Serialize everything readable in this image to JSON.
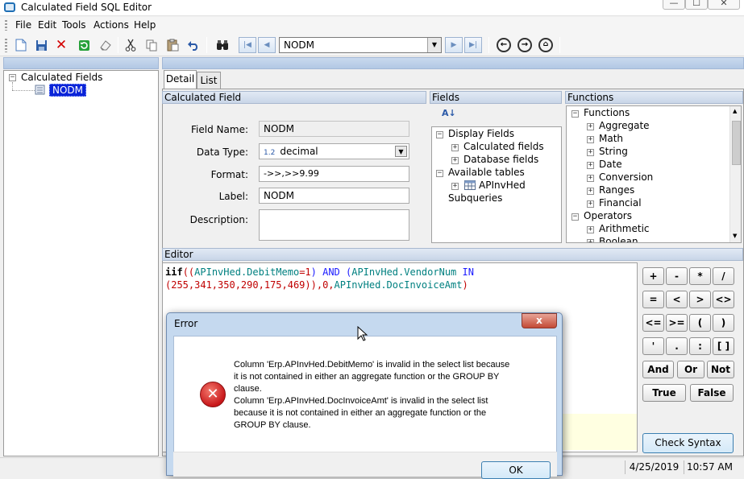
{
  "window": {
    "title": "Calculated Field SQL Editor",
    "minimize": "—",
    "maximize": "☐",
    "close": "✕"
  },
  "menu": [
    "File",
    "Edit",
    "Tools",
    "Actions",
    "Help"
  ],
  "toolbar": {
    "record_select_value": "NODM",
    "icons": [
      "new-icon",
      "save-icon",
      "delete-icon",
      "refresh-icon",
      "clear-icon",
      "cut-icon",
      "copy-icon",
      "paste-icon",
      "undo-icon",
      "find-icon",
      "first-record-icon",
      "prev-record-icon",
      "next-record-icon",
      "last-record-icon",
      "back-icon",
      "forward-icon",
      "home-icon"
    ]
  },
  "tree": {
    "root": "Calculated Fields",
    "selected": "NODM"
  },
  "tabs": [
    "Detail",
    "List"
  ],
  "calculated_field": {
    "header": "Calculated Field",
    "field_name_label": "Field Name:",
    "field_name": "NODM",
    "data_type_label": "Data Type:",
    "data_type_prefix": "1.2",
    "data_type": "decimal",
    "format_label": "Format:",
    "format": "->>,>>9.99",
    "label_label": "Label:",
    "label": "NODM",
    "description_label": "Description:",
    "description": ""
  },
  "fields": {
    "header": "Fields",
    "sort_glyph": "A↓",
    "items": [
      "Display Fields",
      "Calculated fields",
      "Database fields",
      "Available tables",
      "APInvHed",
      "Subqueries"
    ]
  },
  "functions": {
    "header": "Functions",
    "items": [
      "Functions",
      "Aggregate",
      "Math",
      "String",
      "Date",
      "Conversion",
      "Ranges",
      "Financial",
      "Operators",
      "Arithmetic",
      "Boolean"
    ]
  },
  "editor": {
    "header": "Editor",
    "line1": {
      "a": "iif",
      "b": "((",
      "c": "APInvHed.DebitMemo",
      "d": "=1",
      "e": ") AND (",
      "f": "APInvHed.VendorNum",
      "g": " IN"
    },
    "line2": {
      "a": "(255,341,350,290,175,469)",
      "b": "),0,",
      "c": "APInvHed.DocInvoiceAmt",
      "d": ")"
    }
  },
  "keypad": {
    "row1": [
      "+",
      "-",
      "*",
      "/"
    ],
    "row2": [
      "=",
      "<",
      ">",
      "<>"
    ],
    "row3": [
      "<=",
      ">=",
      "(",
      ")"
    ],
    "row4": [
      "'",
      ".",
      ":",
      "[ ]"
    ],
    "row5": [
      "And",
      "Or",
      "Not"
    ],
    "row6": [
      "True",
      "False"
    ],
    "check_syntax": "Check Syntax"
  },
  "status": {
    "date": "4/25/2019",
    "time": "10:57 AM"
  },
  "dialog": {
    "title": "Error",
    "close": "x",
    "icon_glyph": "✕",
    "lines": [
      "Column 'Erp.APInvHed.DebitMemo' is invalid in the select list because",
      "it is not contained in either an aggregate function or the GROUP BY",
      "clause.",
      "Column 'Erp.APInvHed.DocInvoiceAmt' is invalid in the select list",
      "because it is not contained in either an aggregate function or the",
      "GROUP BY clause."
    ],
    "ok": "OK"
  },
  "colors": {
    "code_black": "#000000",
    "code_red": "#c00000",
    "code_blue": "#1a1aff",
    "code_teal": "#008080",
    "accent": "#1f6fb5",
    "selection": "#0a24d8"
  }
}
